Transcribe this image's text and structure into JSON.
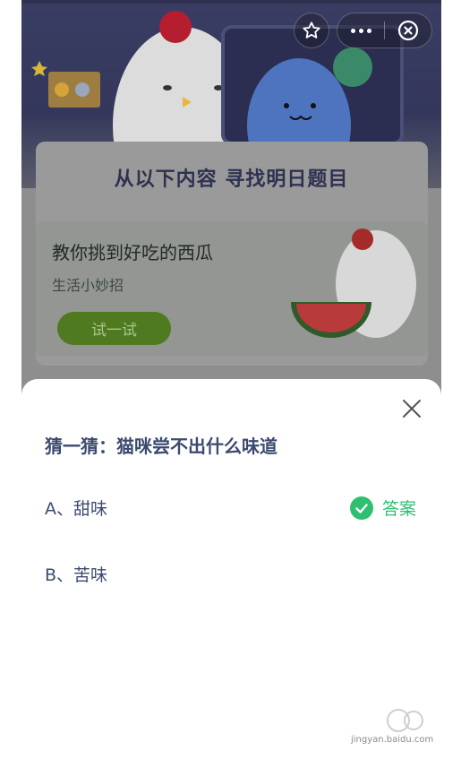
{
  "hero": {
    "title": "从以下内容  寻找明日题目"
  },
  "card": {
    "title": "教你挑到好吃的西瓜",
    "subtitle": "生活小妙招",
    "button": "试一试"
  },
  "sheet": {
    "question": "猜一猜：猫咪尝不出什么味道",
    "options": [
      {
        "label": "A、甜味"
      },
      {
        "label": "B、苦味"
      }
    ],
    "answer_label": "答案"
  },
  "watermark": {
    "text": "jingyan.baidu.com"
  },
  "colors": {
    "answer_green": "#2fbf71",
    "text_blue": "#3c4a6e"
  }
}
